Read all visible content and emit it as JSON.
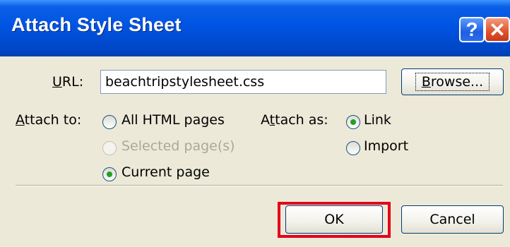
{
  "dialog": {
    "title": "Attach Style Sheet",
    "help_glyph": "?",
    "close_glyph": "✕"
  },
  "url": {
    "label_prefix": "",
    "label_access": "U",
    "label_rest": "RL:",
    "value": "beachtripstylesheet.css",
    "browse_access": "B",
    "browse_rest": "rowse..."
  },
  "attach_to": {
    "label_access": "A",
    "label_rest": "ttach to:",
    "options": [
      {
        "label": "All HTML pages",
        "selected": false,
        "disabled": false
      },
      {
        "label": "Selected page(s)",
        "selected": false,
        "disabled": true
      },
      {
        "label": "Current page",
        "selected": true,
        "disabled": false
      }
    ]
  },
  "attach_as": {
    "label_pre": "A",
    "label_access": "t",
    "label_rest": "tach as:",
    "options": [
      {
        "label": "Link",
        "selected": true
      },
      {
        "label": "Import",
        "selected": false
      }
    ]
  },
  "buttons": {
    "ok": "OK",
    "cancel": "Cancel"
  },
  "colors": {
    "titlebar": "#0054e3",
    "highlight": "#e3001b",
    "radio_dot": "#21a121"
  },
  "icons": [
    "help-icon",
    "close-icon"
  ]
}
